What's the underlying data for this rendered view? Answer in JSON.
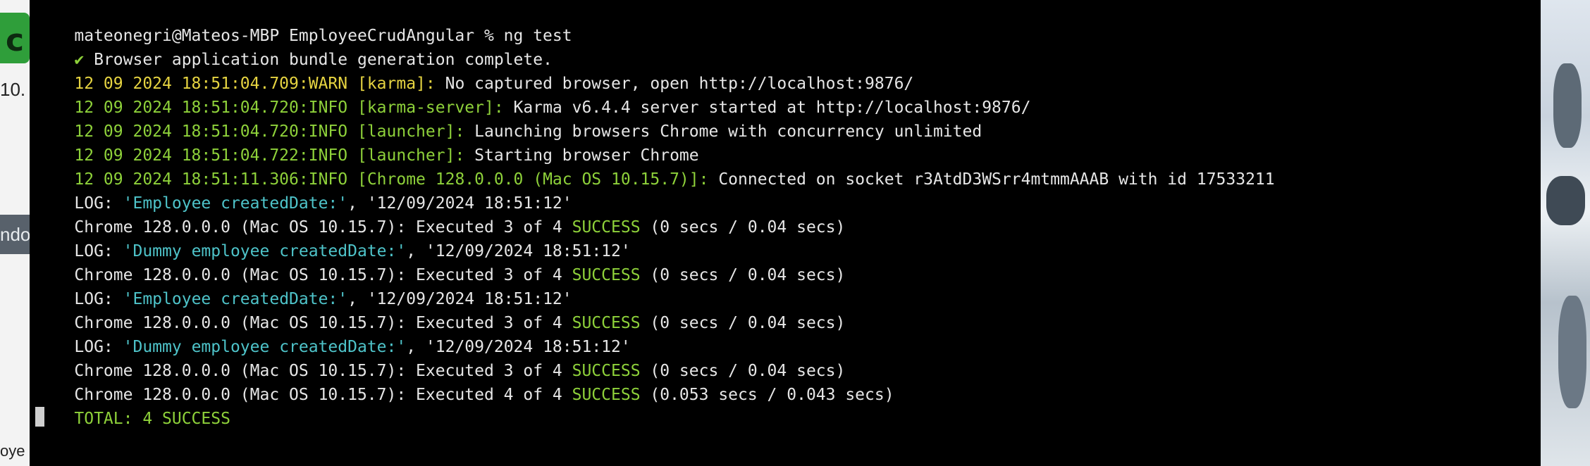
{
  "desktop_left": {
    "snip_1": "10.",
    "snip_2": "ndo",
    "snip_3": "oye"
  },
  "terminal": {
    "prompt": "mateonegri@Mateos-MBP EmployeeCrudAngular % ng test",
    "bundle_check": "✔",
    "bundle_text": " Browser application bundle generation complete.",
    "lines": [
      {
        "ts": "12 09 2024 18:51:04.709:WARN",
        "tag": " [karma]:",
        "msg": " No captured browser, open http://localhost:9876/"
      },
      {
        "ts": "12 09 2024 18:51:04.720:INFO",
        "tag": " [karma-server]:",
        "msg": " Karma v6.4.4 server started at http://localhost:9876/"
      },
      {
        "ts": "12 09 2024 18:51:04.720:INFO",
        "tag": " [launcher]:",
        "msg": " Launching browsers Chrome with concurrency unlimited"
      },
      {
        "ts": "12 09 2024 18:51:04.722:INFO",
        "tag": " [launcher]:",
        "msg": " Starting browser Chrome"
      },
      {
        "ts": "12 09 2024 18:51:11.306:INFO",
        "tag": " [Chrome 128.0.0.0 (Mac OS 10.15.7)]:",
        "msg": " Connected on socket r3AtdD3WSrr4mtmmAAAB with id 17533211"
      }
    ],
    "log_prefix": "LOG: ",
    "log_1": {
      "label": "'Employee createdDate:'",
      "date": ", '12/09/2024 18:51:12'"
    },
    "log_2": {
      "label": "'Dummy employee createdDate:'",
      "date": ", '12/09/2024 18:51:12'"
    },
    "exec_prefix": "Chrome 128.0.0.0 (Mac OS 10.15.7): Executed 3 of 4 ",
    "exec_final_prefix": "Chrome 128.0.0.0 (Mac OS 10.15.7): Executed 4 of 4 ",
    "success": "SUCCESS",
    "exec_time": " (0 secs / 0.04 secs)",
    "exec_final_time": " (0.053 secs / 0.043 secs)",
    "total": "TOTAL: 4 SUCCESS"
  },
  "colors": {
    "background": "#000000",
    "text": "#e6e6e6",
    "green": "#8ed13a",
    "yellow": "#e6d441",
    "cyan": "#4ec3c9"
  }
}
